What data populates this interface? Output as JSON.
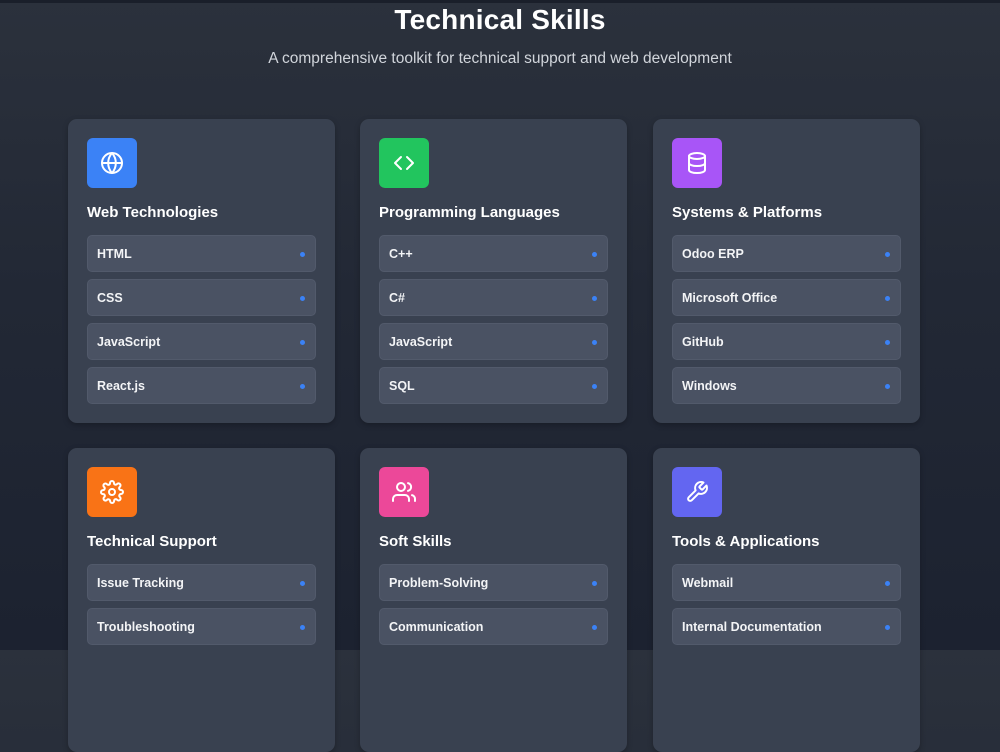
{
  "header": {
    "title": "Technical Skills",
    "subtitle": "A comprehensive toolkit for technical support and web development"
  },
  "colors": {
    "accent_dot": "#3b82f6",
    "web": "#3b82f6",
    "programming": "#22c55e",
    "systems": "#a855f7",
    "support": "#f97316",
    "soft": "#ec4899",
    "tools": "#6366f1"
  },
  "cards": [
    {
      "icon": "globe-icon",
      "title": "Web Technologies",
      "items": [
        "HTML",
        "CSS",
        "JavaScript",
        "React.js"
      ]
    },
    {
      "icon": "code-icon",
      "title": "Programming Languages",
      "items": [
        "C++",
        "C#",
        "JavaScript",
        "SQL"
      ]
    },
    {
      "icon": "database-icon",
      "title": "Systems & Platforms",
      "items": [
        "Odoo ERP",
        "Microsoft Office",
        "GitHub",
        "Windows"
      ]
    },
    {
      "icon": "gear-icon",
      "title": "Technical Support",
      "items": [
        "Issue Tracking",
        "Troubleshooting"
      ]
    },
    {
      "icon": "users-icon",
      "title": "Soft Skills",
      "items": [
        "Problem-Solving",
        "Communication"
      ]
    },
    {
      "icon": "wrench-icon",
      "title": "Tools & Applications",
      "items": [
        "Webmail",
        "Internal Documentation"
      ]
    }
  ]
}
